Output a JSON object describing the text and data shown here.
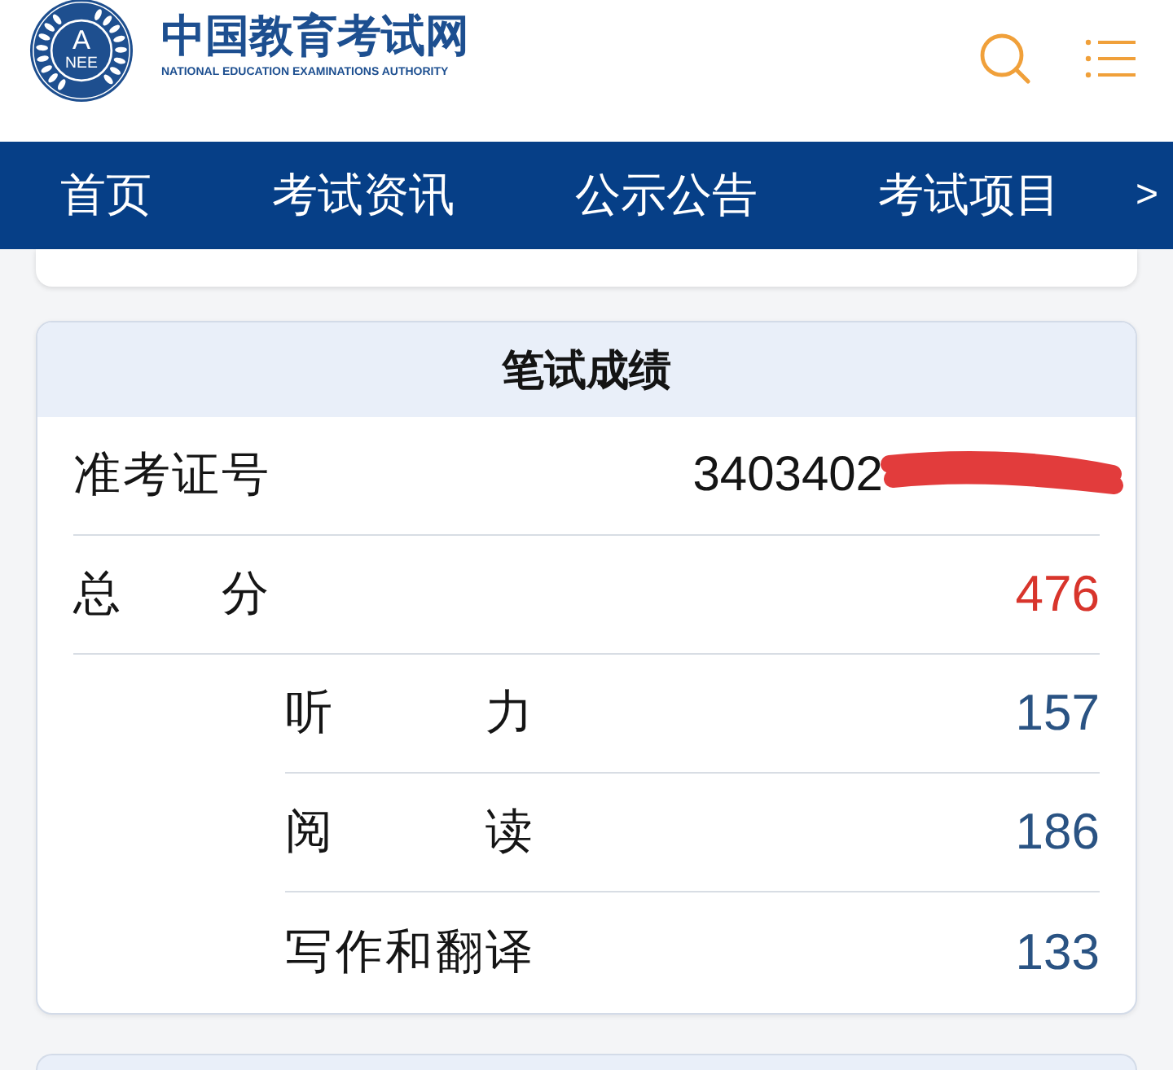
{
  "header": {
    "logo": {
      "emblem_letter": "A",
      "emblem_text": "NEE",
      "title": "中国教育考试网",
      "subtitle": "NATIONAL EDUCATION EXAMINATIONS AUTHORITY"
    }
  },
  "nav": {
    "items": [
      "首页",
      "考试资讯",
      "公示公告",
      "考试项目"
    ],
    "more": ">"
  },
  "score_card": {
    "title": "笔试成绩",
    "rows": [
      {
        "kind": "id",
        "label": "准考证号",
        "value": "3403402",
        "redacted": true
      },
      {
        "kind": "total",
        "label": "总 分",
        "value": "476",
        "children": [
          {
            "label": "听 力",
            "value": "157"
          },
          {
            "label": "阅 读",
            "value": "186"
          },
          {
            "label": "写作和翻译",
            "value": "133"
          }
        ]
      }
    ]
  }
}
